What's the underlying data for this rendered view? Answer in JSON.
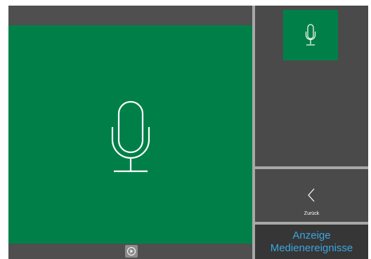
{
  "main": {
    "preview_icon": "microphone-icon"
  },
  "playback": {
    "play_icon": "play-circle-icon"
  },
  "sidebar": {
    "thumbnail_icon": "microphone-icon",
    "back_icon": "chevron-left-icon",
    "back_label": "Zurück",
    "events_label_line1": "Anzeige",
    "events_label_line2": "Medienereignisse"
  },
  "colors": {
    "media_green": "#008048",
    "panel_gray": "#4a4a4a",
    "divider_gray": "#a8a8a8",
    "accent_blue": "#3aa6e0"
  }
}
